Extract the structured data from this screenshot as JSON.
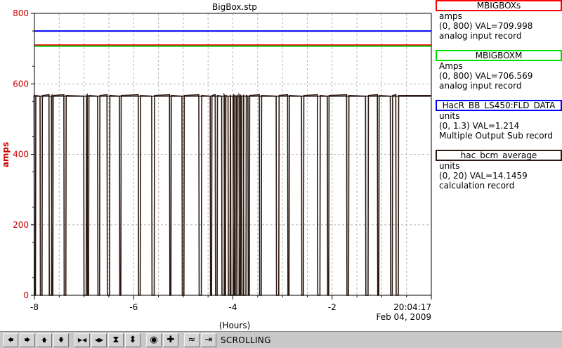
{
  "plot": {
    "title": "BigBox.stp",
    "ylabel": "amps",
    "xlabel": "(Hours)",
    "time_label": "20:04:17",
    "date_label": "Feb 04, 2009"
  },
  "chart_data": {
    "type": "line",
    "title": "BigBox.stp",
    "xlabel": "(Hours)",
    "ylabel": "amps",
    "xlim": [
      -8,
      0
    ],
    "ylim": [
      0,
      800
    ],
    "xticks": [
      "-8",
      "-6",
      "-4",
      "-2"
    ],
    "yticks": [
      "0",
      "200",
      "400",
      "600",
      "800"
    ],
    "grid": true,
    "series": [
      {
        "name": "MBIGBOXs",
        "color": "#ff0000",
        "values": [
          710,
          710
        ]
      },
      {
        "name": "MBIGBOXM",
        "color": "#00cc00",
        "values": [
          707,
          707
        ]
      },
      {
        "name": "HacR_BB_LS450:FLD_DATA",
        "color": "#0000ff",
        "values": [
          750,
          750
        ]
      },
      {
        "name": "hac_bcm_average",
        "color": "#2b1810",
        "baseline": 567,
        "trips_hours": [
          -8.0,
          -7.88,
          -7.7,
          -7.65,
          -7.4,
          -7.0,
          -6.93,
          -6.72,
          -6.53,
          -6.28,
          -5.9,
          -5.63,
          -5.27,
          -5.02,
          -4.68,
          -4.45,
          -4.35,
          -4.22,
          -4.17,
          -4.09,
          -4.04,
          -3.99,
          -3.95,
          -3.92,
          -3.87,
          -3.82,
          -3.78,
          -3.69,
          -3.46,
          -3.12,
          -2.89,
          -2.61,
          -2.29,
          -2.09,
          -1.7,
          -1.32,
          -1.08,
          -0.82,
          -0.71
        ]
      }
    ]
  },
  "legend": [
    {
      "name": "MBIGBOXs",
      "color": "#ff0000",
      "units": "amps",
      "range_val": "(0, 800)  VAL=709.998",
      "rtype": "analog input record"
    },
    {
      "name": "MBIGBOXM",
      "color": "#00dd00",
      "units": "Amps",
      "range_val": "(0, 800)  VAL=706.569",
      "rtype": "analog input record"
    },
    {
      "name": "HacR_BB_LS450:FLD_DATA",
      "color": "#0000ff",
      "units": "units",
      "range_val": "(0, 1.3)  VAL=1.214",
      "rtype": "Multiple Output Sub record"
    },
    {
      "name": "hac_bcm_average",
      "color": "#2b1810",
      "units": "units",
      "range_val": "(0, 20)  VAL=14.1459",
      "rtype": "calculation record"
    }
  ],
  "toolbar": {
    "buttons": [
      {
        "name": "pan-left-button",
        "glyph": "🡄"
      },
      {
        "name": "pan-right-button",
        "glyph": "🡆"
      },
      {
        "name": "pan-up-button",
        "glyph": "🡅"
      },
      {
        "name": "pan-down-button",
        "glyph": "🡇"
      },
      {
        "name": "zoom-in-x-button",
        "glyph": "▶◀"
      },
      {
        "name": "zoom-out-x-button",
        "glyph": "◀▶"
      },
      {
        "name": "zoom-in-y-button",
        "glyph": "⧗"
      },
      {
        "name": "zoom-out-y-button",
        "glyph": "⬍"
      },
      {
        "name": "record-button",
        "glyph": "◉"
      },
      {
        "name": "add-button",
        "glyph": "✚"
      },
      {
        "name": "autoscale-button",
        "glyph": "≈"
      },
      {
        "name": "scroll-to-now-button",
        "glyph": "⇥"
      }
    ],
    "status": "SCROLLING"
  }
}
